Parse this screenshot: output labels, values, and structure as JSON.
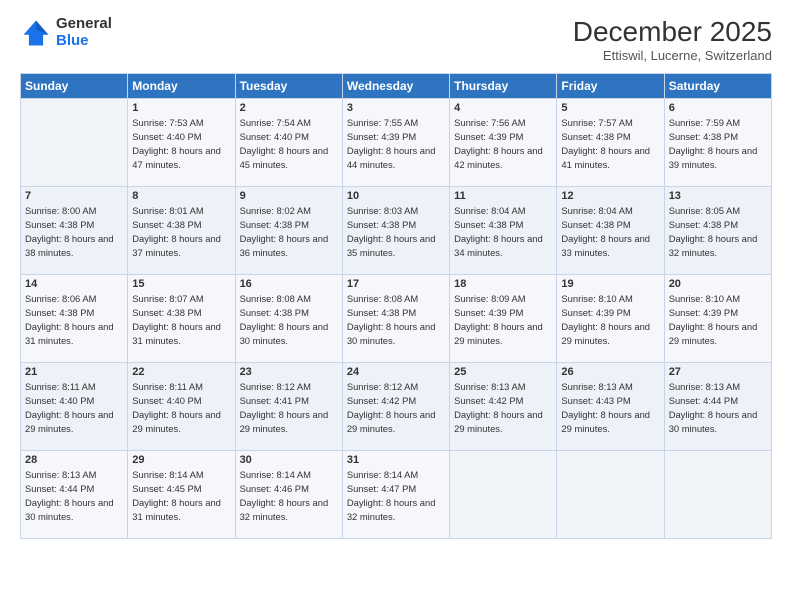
{
  "logo": {
    "general": "General",
    "blue": "Blue"
  },
  "header": {
    "month": "December 2025",
    "location": "Ettiswil, Lucerne, Switzerland"
  },
  "weekdays": [
    "Sunday",
    "Monday",
    "Tuesday",
    "Wednesday",
    "Thursday",
    "Friday",
    "Saturday"
  ],
  "weeks": [
    [
      {
        "day": "",
        "sunrise": "",
        "sunset": "",
        "daylight": ""
      },
      {
        "day": "1",
        "sunrise": "Sunrise: 7:53 AM",
        "sunset": "Sunset: 4:40 PM",
        "daylight": "Daylight: 8 hours and 47 minutes."
      },
      {
        "day": "2",
        "sunrise": "Sunrise: 7:54 AM",
        "sunset": "Sunset: 4:40 PM",
        "daylight": "Daylight: 8 hours and 45 minutes."
      },
      {
        "day": "3",
        "sunrise": "Sunrise: 7:55 AM",
        "sunset": "Sunset: 4:39 PM",
        "daylight": "Daylight: 8 hours and 44 minutes."
      },
      {
        "day": "4",
        "sunrise": "Sunrise: 7:56 AM",
        "sunset": "Sunset: 4:39 PM",
        "daylight": "Daylight: 8 hours and 42 minutes."
      },
      {
        "day": "5",
        "sunrise": "Sunrise: 7:57 AM",
        "sunset": "Sunset: 4:38 PM",
        "daylight": "Daylight: 8 hours and 41 minutes."
      },
      {
        "day": "6",
        "sunrise": "Sunrise: 7:59 AM",
        "sunset": "Sunset: 4:38 PM",
        "daylight": "Daylight: 8 hours and 39 minutes."
      }
    ],
    [
      {
        "day": "7",
        "sunrise": "Sunrise: 8:00 AM",
        "sunset": "Sunset: 4:38 PM",
        "daylight": "Daylight: 8 hours and 38 minutes."
      },
      {
        "day": "8",
        "sunrise": "Sunrise: 8:01 AM",
        "sunset": "Sunset: 4:38 PM",
        "daylight": "Daylight: 8 hours and 37 minutes."
      },
      {
        "day": "9",
        "sunrise": "Sunrise: 8:02 AM",
        "sunset": "Sunset: 4:38 PM",
        "daylight": "Daylight: 8 hours and 36 minutes."
      },
      {
        "day": "10",
        "sunrise": "Sunrise: 8:03 AM",
        "sunset": "Sunset: 4:38 PM",
        "daylight": "Daylight: 8 hours and 35 minutes."
      },
      {
        "day": "11",
        "sunrise": "Sunrise: 8:04 AM",
        "sunset": "Sunset: 4:38 PM",
        "daylight": "Daylight: 8 hours and 34 minutes."
      },
      {
        "day": "12",
        "sunrise": "Sunrise: 8:04 AM",
        "sunset": "Sunset: 4:38 PM",
        "daylight": "Daylight: 8 hours and 33 minutes."
      },
      {
        "day": "13",
        "sunrise": "Sunrise: 8:05 AM",
        "sunset": "Sunset: 4:38 PM",
        "daylight": "Daylight: 8 hours and 32 minutes."
      }
    ],
    [
      {
        "day": "14",
        "sunrise": "Sunrise: 8:06 AM",
        "sunset": "Sunset: 4:38 PM",
        "daylight": "Daylight: 8 hours and 31 minutes."
      },
      {
        "day": "15",
        "sunrise": "Sunrise: 8:07 AM",
        "sunset": "Sunset: 4:38 PM",
        "daylight": "Daylight: 8 hours and 31 minutes."
      },
      {
        "day": "16",
        "sunrise": "Sunrise: 8:08 AM",
        "sunset": "Sunset: 4:38 PM",
        "daylight": "Daylight: 8 hours and 30 minutes."
      },
      {
        "day": "17",
        "sunrise": "Sunrise: 8:08 AM",
        "sunset": "Sunset: 4:38 PM",
        "daylight": "Daylight: 8 hours and 30 minutes."
      },
      {
        "day": "18",
        "sunrise": "Sunrise: 8:09 AM",
        "sunset": "Sunset: 4:39 PM",
        "daylight": "Daylight: 8 hours and 29 minutes."
      },
      {
        "day": "19",
        "sunrise": "Sunrise: 8:10 AM",
        "sunset": "Sunset: 4:39 PM",
        "daylight": "Daylight: 8 hours and 29 minutes."
      },
      {
        "day": "20",
        "sunrise": "Sunrise: 8:10 AM",
        "sunset": "Sunset: 4:39 PM",
        "daylight": "Daylight: 8 hours and 29 minutes."
      }
    ],
    [
      {
        "day": "21",
        "sunrise": "Sunrise: 8:11 AM",
        "sunset": "Sunset: 4:40 PM",
        "daylight": "Daylight: 8 hours and 29 minutes."
      },
      {
        "day": "22",
        "sunrise": "Sunrise: 8:11 AM",
        "sunset": "Sunset: 4:40 PM",
        "daylight": "Daylight: 8 hours and 29 minutes."
      },
      {
        "day": "23",
        "sunrise": "Sunrise: 8:12 AM",
        "sunset": "Sunset: 4:41 PM",
        "daylight": "Daylight: 8 hours and 29 minutes."
      },
      {
        "day": "24",
        "sunrise": "Sunrise: 8:12 AM",
        "sunset": "Sunset: 4:42 PM",
        "daylight": "Daylight: 8 hours and 29 minutes."
      },
      {
        "day": "25",
        "sunrise": "Sunrise: 8:13 AM",
        "sunset": "Sunset: 4:42 PM",
        "daylight": "Daylight: 8 hours and 29 minutes."
      },
      {
        "day": "26",
        "sunrise": "Sunrise: 8:13 AM",
        "sunset": "Sunset: 4:43 PM",
        "daylight": "Daylight: 8 hours and 29 minutes."
      },
      {
        "day": "27",
        "sunrise": "Sunrise: 8:13 AM",
        "sunset": "Sunset: 4:44 PM",
        "daylight": "Daylight: 8 hours and 30 minutes."
      }
    ],
    [
      {
        "day": "28",
        "sunrise": "Sunrise: 8:13 AM",
        "sunset": "Sunset: 4:44 PM",
        "daylight": "Daylight: 8 hours and 30 minutes."
      },
      {
        "day": "29",
        "sunrise": "Sunrise: 8:14 AM",
        "sunset": "Sunset: 4:45 PM",
        "daylight": "Daylight: 8 hours and 31 minutes."
      },
      {
        "day": "30",
        "sunrise": "Sunrise: 8:14 AM",
        "sunset": "Sunset: 4:46 PM",
        "daylight": "Daylight: 8 hours and 32 minutes."
      },
      {
        "day": "31",
        "sunrise": "Sunrise: 8:14 AM",
        "sunset": "Sunset: 4:47 PM",
        "daylight": "Daylight: 8 hours and 32 minutes."
      },
      {
        "day": "",
        "sunrise": "",
        "sunset": "",
        "daylight": ""
      },
      {
        "day": "",
        "sunrise": "",
        "sunset": "",
        "daylight": ""
      },
      {
        "day": "",
        "sunrise": "",
        "sunset": "",
        "daylight": ""
      }
    ]
  ]
}
